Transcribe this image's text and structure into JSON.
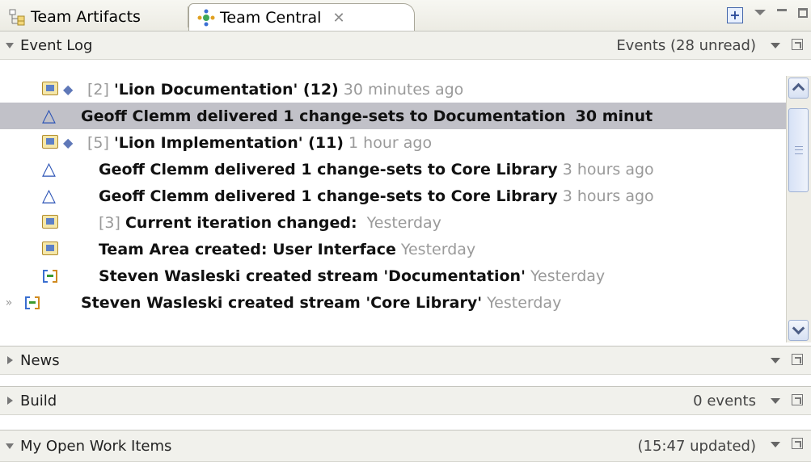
{
  "tabs": [
    {
      "label": "Team Artifacts",
      "icon": "hierarchy-icon"
    },
    {
      "label": "Team Central",
      "icon": "team-central-icon",
      "active": true
    }
  ],
  "toolbar_icons": [
    "add-section-icon",
    "view-menu-icon",
    "minimize-icon",
    "maximize-icon"
  ],
  "event_log": {
    "title": "Event Log",
    "info": "Events (28 unread)",
    "rows": [
      {
        "id": "[2]",
        "bold": "'Lion Documentation' (12)",
        "time": "30 minutes ago",
        "icon": "work-item-icon",
        "badge": "diamond-icon"
      },
      {
        "bold": "Geoff Clemm delivered 1 change-sets to Documentation",
        "time": "30 minut",
        "icon": "delta-icon",
        "selected": true
      },
      {
        "id": "[5]",
        "bold": "'Lion Implementation' (11)",
        "time": "1 hour ago",
        "icon": "work-item-icon",
        "badge": "diamond-icon"
      },
      {
        "bold": "Geoff Clemm delivered 1 change-sets to Core Library",
        "time": "3 hours ago",
        "icon": "delta-icon"
      },
      {
        "bold": "Geoff Clemm delivered 1 change-sets to Core Library",
        "time": "3 hours ago",
        "icon": "delta-icon"
      },
      {
        "id": "[3]",
        "bold": "Current iteration changed:",
        "time": "Yesterday",
        "icon": "work-item-icon"
      },
      {
        "bold": "Team Area created: User Interface",
        "time": "Yesterday",
        "icon": "work-item-icon"
      },
      {
        "bold": "Steven Wasleski created stream 'Documentation'",
        "time": "Yesterday",
        "icon": "stream-icon"
      },
      {
        "bold": "Steven Wasleski created stream 'Core Library'",
        "time": "Yesterday",
        "icon": "stream-icon",
        "more": "»"
      }
    ]
  },
  "news": {
    "title": "News",
    "info": ""
  },
  "build": {
    "title": "Build",
    "info": "0 events"
  },
  "work_items": {
    "title": "My Open Work Items",
    "info": "(15:47 updated)"
  }
}
